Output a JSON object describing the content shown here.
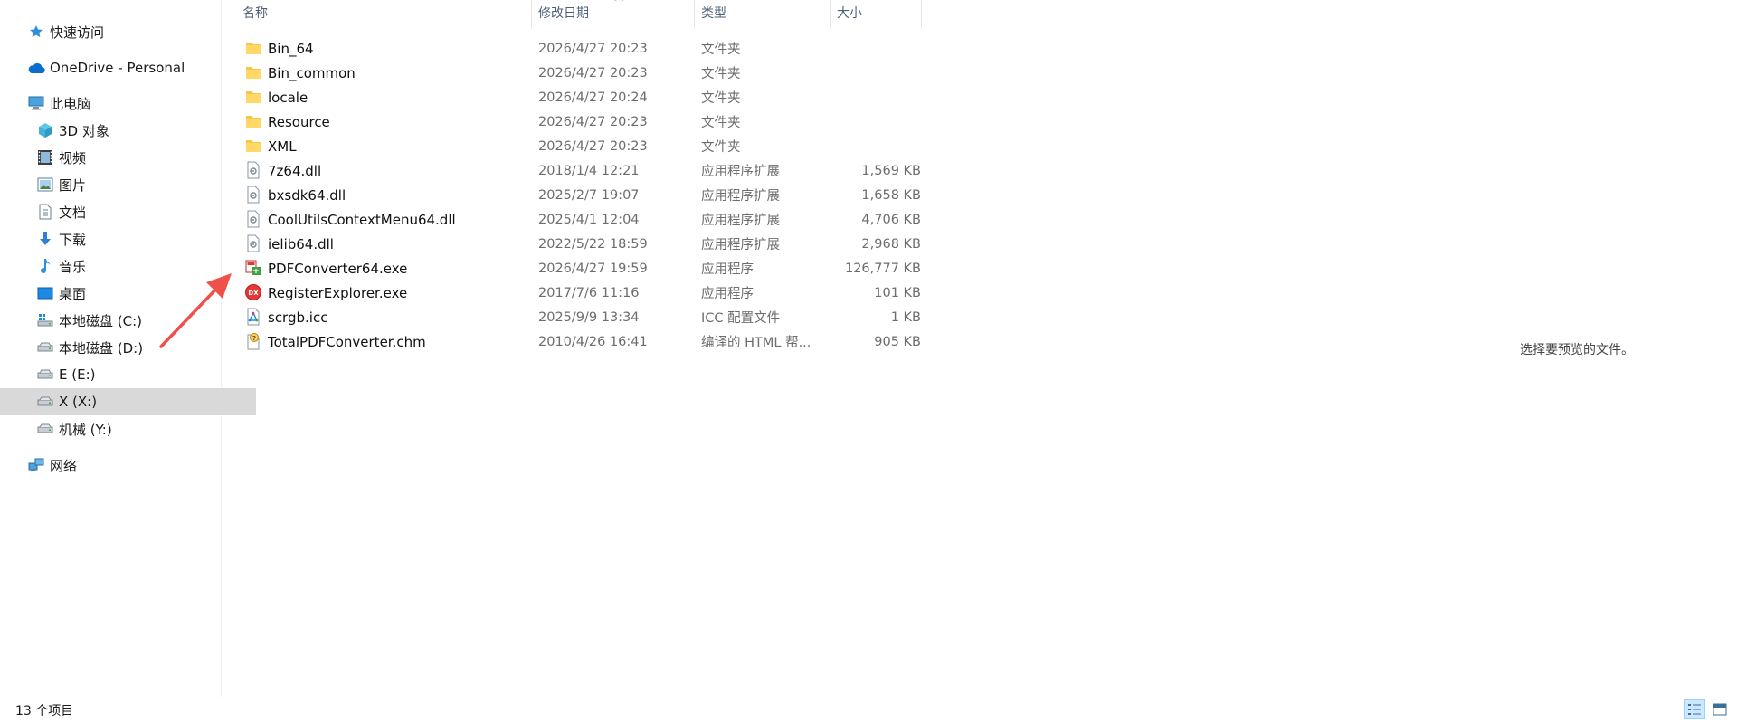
{
  "nav": {
    "items": [
      {
        "label": "快速访问",
        "icon": "quick-access-star-icon",
        "level": 0
      },
      {
        "label": "OneDrive - Personal",
        "icon": "onedrive-cloud-icon",
        "level": 0
      },
      {
        "label": "此电脑",
        "icon": "this-pc-icon",
        "level": 0
      },
      {
        "label": "3D 对象",
        "icon": "3d-objects-icon",
        "level": 1
      },
      {
        "label": "视频",
        "icon": "videos-icon",
        "level": 1
      },
      {
        "label": "图片",
        "icon": "pictures-icon",
        "level": 1
      },
      {
        "label": "文档",
        "icon": "documents-icon",
        "level": 1
      },
      {
        "label": "下载",
        "icon": "downloads-icon",
        "level": 1
      },
      {
        "label": "音乐",
        "icon": "music-icon",
        "level": 1
      },
      {
        "label": "桌面",
        "icon": "desktop-icon",
        "level": 1
      },
      {
        "label": "本地磁盘 (C:)",
        "icon": "system-drive-icon",
        "level": 1
      },
      {
        "label": "本地磁盘 (D:)",
        "icon": "drive-icon",
        "level": 1
      },
      {
        "label": "E (E:)",
        "icon": "drive-icon",
        "level": 1
      },
      {
        "label": "X (X:)",
        "icon": "drive-icon",
        "level": 1,
        "selected": true
      },
      {
        "label": "机械 (Y:)",
        "icon": "drive-icon",
        "level": 1
      },
      {
        "label": "网络",
        "icon": "network-icon",
        "level": 0
      }
    ]
  },
  "columns": {
    "name": "名称",
    "date": "修改日期",
    "type": "类型",
    "size": "大小"
  },
  "files": [
    {
      "name": "Bin_64",
      "date": "2026/4/27 20:23",
      "type": "文件夹",
      "size": "",
      "icon": "folder-icon"
    },
    {
      "name": "Bin_common",
      "date": "2026/4/27 20:23",
      "type": "文件夹",
      "size": "",
      "icon": "folder-icon"
    },
    {
      "name": "locale",
      "date": "2026/4/27 20:24",
      "type": "文件夹",
      "size": "",
      "icon": "folder-icon"
    },
    {
      "name": "Resource",
      "date": "2026/4/27 20:23",
      "type": "文件夹",
      "size": "",
      "icon": "folder-icon"
    },
    {
      "name": "XML",
      "date": "2026/4/27 20:23",
      "type": "文件夹",
      "size": "",
      "icon": "folder-icon"
    },
    {
      "name": "7z64.dll",
      "date": "2018/1/4 12:21",
      "type": "应用程序扩展",
      "size": "1,569 KB",
      "icon": "dll-file-icon"
    },
    {
      "name": "bxsdk64.dll",
      "date": "2025/2/7 19:07",
      "type": "应用程序扩展",
      "size": "1,658 KB",
      "icon": "dll-file-icon"
    },
    {
      "name": "CoolUtilsContextMenu64.dll",
      "date": "2025/4/1 12:04",
      "type": "应用程序扩展",
      "size": "4,706 KB",
      "icon": "dll-file-icon"
    },
    {
      "name": "ielib64.dll",
      "date": "2022/5/22 18:59",
      "type": "应用程序扩展",
      "size": "2,968 KB",
      "icon": "dll-file-icon"
    },
    {
      "name": "PDFConverter64.exe",
      "date": "2026/4/27 19:59",
      "type": "应用程序",
      "size": "126,777 KB",
      "icon": "pdf-converter-app-icon"
    },
    {
      "name": "RegisterExplorer.exe",
      "date": "2017/7/6 11:16",
      "type": "应用程序",
      "size": "101 KB",
      "icon": "register-explorer-app-icon"
    },
    {
      "name": "scrgb.icc",
      "date": "2025/9/9 13:34",
      "type": "ICC 配置文件",
      "size": "1 KB",
      "icon": "icc-profile-icon"
    },
    {
      "name": "TotalPDFConverter.chm",
      "date": "2010/4/26 16:41",
      "type": "编译的 HTML 帮...",
      "size": "905 KB",
      "icon": "chm-help-file-icon"
    }
  ],
  "preview": {
    "message": "选择要预览的文件。"
  },
  "status": {
    "item_count": "13 个项目"
  },
  "colors": {
    "selected_nav": "#d9d9d9",
    "header_text": "#4c607a",
    "annotation_arrow": "#f0504a",
    "folder": "#f5c746"
  }
}
